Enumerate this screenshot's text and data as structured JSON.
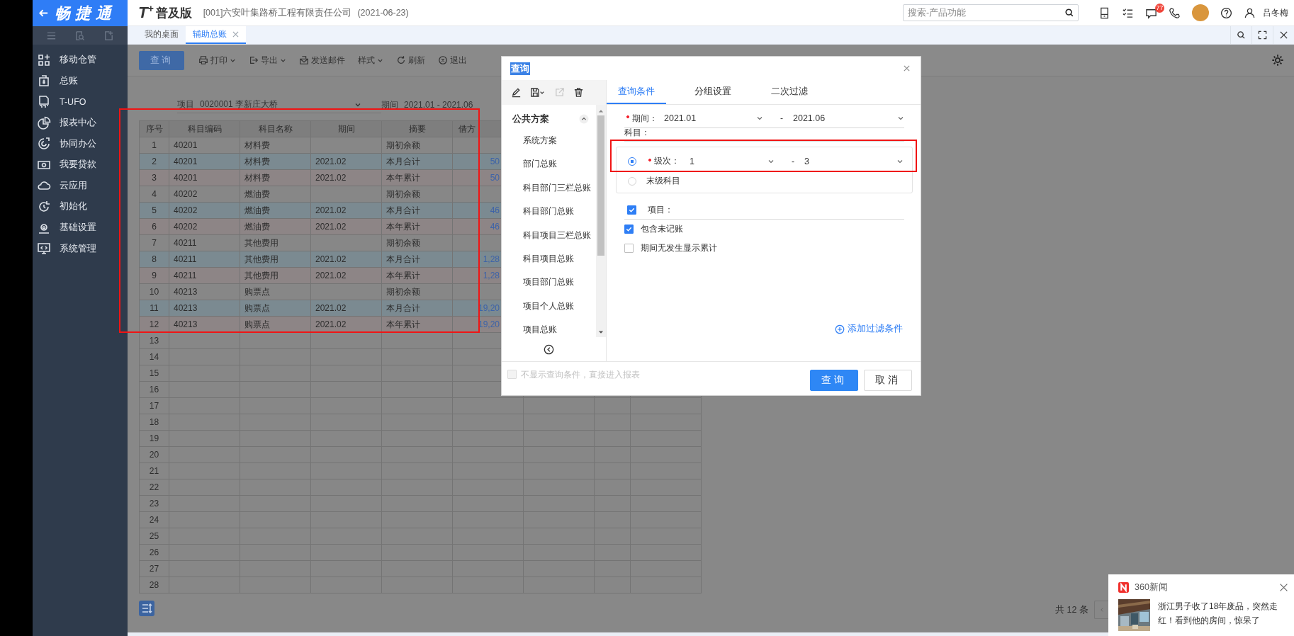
{
  "app": {
    "logo": "畅捷通",
    "edition_mark": "T$^{+}$",
    "edition": "普及版",
    "company": "[001]六安叶集路桥工程有限责任公司",
    "date": "(2021-06-23)"
  },
  "header": {
    "search": {
      "placeholder": "搜索-产品功能"
    },
    "message_badge": "77",
    "user": "吕冬梅"
  },
  "sidebar": {
    "items": [
      {
        "label": "移动仓管"
      },
      {
        "label": "总账"
      },
      {
        "label": "T-UFO"
      },
      {
        "label": "报表中心"
      },
      {
        "label": "协同办公"
      },
      {
        "label": "我要贷款"
      },
      {
        "label": "云应用"
      },
      {
        "label": "初始化"
      },
      {
        "label": "基础设置"
      },
      {
        "label": "系统管理"
      }
    ]
  },
  "tabs": [
    {
      "label": "我的桌面",
      "selected": false,
      "closable": false
    },
    {
      "label": "辅助总账",
      "selected": true,
      "closable": true
    }
  ],
  "toolbar": {
    "buttons": [
      {
        "label": "查询",
        "kind": "primary"
      },
      {
        "label": "打印",
        "kind": "menu"
      },
      {
        "label": "导出",
        "kind": "menu"
      },
      {
        "label": "发送邮件",
        "kind": "plain"
      },
      {
        "label": "样式",
        "kind": "menu"
      },
      {
        "label": "刷新",
        "kind": "plain"
      },
      {
        "label": "退出",
        "kind": "plain"
      }
    ]
  },
  "filters": [
    {
      "label": "项目",
      "value": "0020001 李新庄大桥",
      "dropdown": true
    },
    {
      "label": "期间",
      "value": "2021.01 - 2021.06",
      "dropdown": false
    }
  ],
  "table": {
    "columns": [
      "序号",
      "科目编码",
      "科目名称",
      "期间",
      "摘要",
      "借方"
    ],
    "rows": [
      {
        "kind": "opening",
        "cells": [
          "1",
          "40201",
          "材料费",
          "",
          "期初余额",
          ""
        ]
      },
      {
        "kind": "month",
        "cells": [
          "2",
          "40201",
          "材料费",
          "2021.02",
          "本月合计",
          "50"
        ]
      },
      {
        "kind": "year",
        "cells": [
          "3",
          "40201",
          "材料费",
          "2021.02",
          "本年累计",
          "50"
        ]
      },
      {
        "kind": "opening",
        "cells": [
          "4",
          "40202",
          "燃油费",
          "",
          "期初余额",
          ""
        ]
      },
      {
        "kind": "month",
        "cells": [
          "5",
          "40202",
          "燃油费",
          "2021.02",
          "本月合计",
          "46"
        ]
      },
      {
        "kind": "year",
        "cells": [
          "6",
          "40202",
          "燃油费",
          "2021.02",
          "本年累计",
          "46"
        ]
      },
      {
        "kind": "opening",
        "cells": [
          "7",
          "40211",
          "其他费用",
          "",
          "期初余额",
          ""
        ]
      },
      {
        "kind": "month",
        "cells": [
          "8",
          "40211",
          "其他费用",
          "2021.02",
          "本月合计",
          "1,28"
        ]
      },
      {
        "kind": "year",
        "cells": [
          "9",
          "40211",
          "其他费用",
          "2021.02",
          "本年累计",
          "1,28"
        ]
      },
      {
        "kind": "opening",
        "cells": [
          "10",
          "40213",
          "购票点",
          "",
          "期初余额",
          ""
        ]
      },
      {
        "kind": "month",
        "cells": [
          "11",
          "40213",
          "购票点",
          "2021.02",
          "本月合计",
          "19,20"
        ]
      },
      {
        "kind": "year",
        "cells": [
          "12",
          "40213",
          "购票点",
          "2021.02",
          "本年累计",
          "19,20"
        ]
      }
    ],
    "blank_rows": [
      "13",
      "14",
      "15",
      "16",
      "17",
      "18",
      "19",
      "20",
      "21",
      "22",
      "23",
      "24",
      "25",
      "26",
      "27",
      "28"
    ]
  },
  "pager": {
    "total": "共 12 条"
  },
  "dialog": {
    "title": "查询",
    "schemes": {
      "group": "公共方案",
      "expanded": true,
      "items": [
        "系统方案",
        "部门总账",
        "科目部门三栏总账",
        "科目部门总账",
        "科目项目三栏总账",
        "科目项目总账",
        "项目部门总账",
        "项目个人总账",
        "项目总账"
      ]
    },
    "tabs": [
      {
        "label": "查询条件",
        "selected": true
      },
      {
        "label": "分组设置",
        "selected": false
      },
      {
        "label": "二次过滤",
        "selected": false
      }
    ],
    "period": {
      "label": "期间：",
      "required": true,
      "from": "2021.01",
      "separator": "-",
      "to": "2021.06"
    },
    "subject_label": "科目：",
    "levels": [
      {
        "kind": "range",
        "label": "级次：",
        "required": true,
        "selected": true,
        "from": "1",
        "separator": "-",
        "to": "3"
      },
      {
        "kind": "plain",
        "label": "末级科目",
        "required": false,
        "selected": false
      }
    ],
    "project": {
      "label": "项目：",
      "checked": true
    },
    "options": [
      {
        "label": "包含未记账",
        "checked": true
      },
      {
        "label": "期间无发生显示累计",
        "checked": false
      }
    ],
    "add_filter": "添加过滤条件",
    "skip_option": {
      "label": "不显示查询条件，直接进入报表",
      "checked": false,
      "disabled": true
    },
    "buttons": [
      {
        "label": "查询",
        "kind": "primary"
      },
      {
        "label": "取消",
        "kind": "default"
      }
    ]
  },
  "news": {
    "source": "360新闻",
    "headline": "浙江男子收了18年废品，突然走红！看到他的房间，惊呆了"
  }
}
